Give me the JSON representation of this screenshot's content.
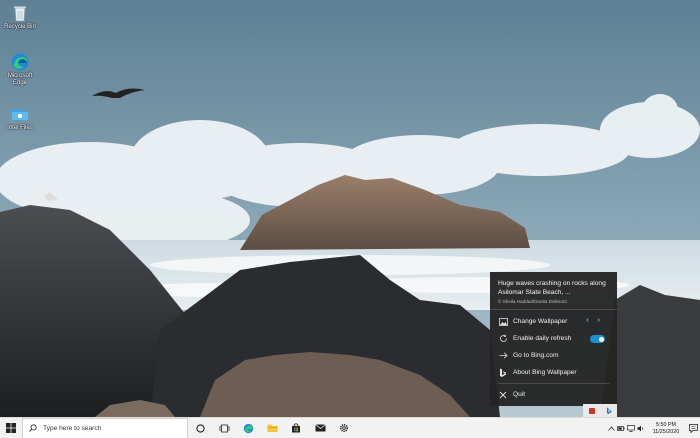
{
  "desktop": {
    "icons": [
      {
        "label": "Recycle Bin"
      },
      {
        "label": "Microsoft Edge"
      },
      {
        "label": "Intel Files"
      }
    ]
  },
  "popup": {
    "image_title": "Huge waves crashing on rocks along Asilomar State Beach, ...",
    "credit": "© Sheila Haddad/Danita Delimont",
    "items": {
      "change_wallpaper": "Change Wallpaper",
      "enable_daily_refresh": "Enable daily refresh",
      "go_to_bing": "Go to Bing.com",
      "about": "About Bing Wallpaper",
      "quit": "Quit"
    },
    "daily_refresh_enabled": true
  },
  "taskbar": {
    "search_placeholder": "Type here to search",
    "clock_time": "5:50 PM",
    "clock_date": "11/25/2020"
  },
  "colors": {
    "accent": "#1b8fd4",
    "popup_bg": "#242424",
    "taskbar_bg": "#f2f2f2"
  }
}
